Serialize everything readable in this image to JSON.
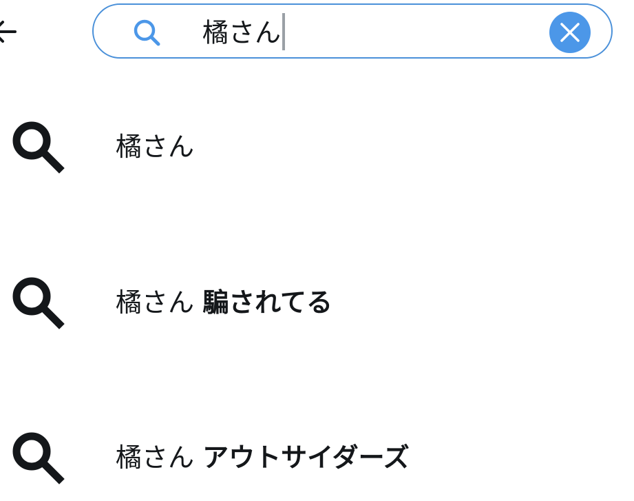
{
  "search": {
    "query": "橘さん",
    "icon": "search-icon",
    "clear_icon": "close-icon",
    "accent_color": "#4c97e8"
  },
  "header": {
    "back_icon": "back-arrow-icon"
  },
  "suggestions": [
    {
      "prefix": "橘さん",
      "suffix": "",
      "icon": "search-icon"
    },
    {
      "prefix": "橘さん",
      "suffix": "騙されてる",
      "icon": "search-icon"
    },
    {
      "prefix": "橘さん",
      "suffix": "アウトサイダーズ",
      "icon": "search-icon"
    }
  ]
}
